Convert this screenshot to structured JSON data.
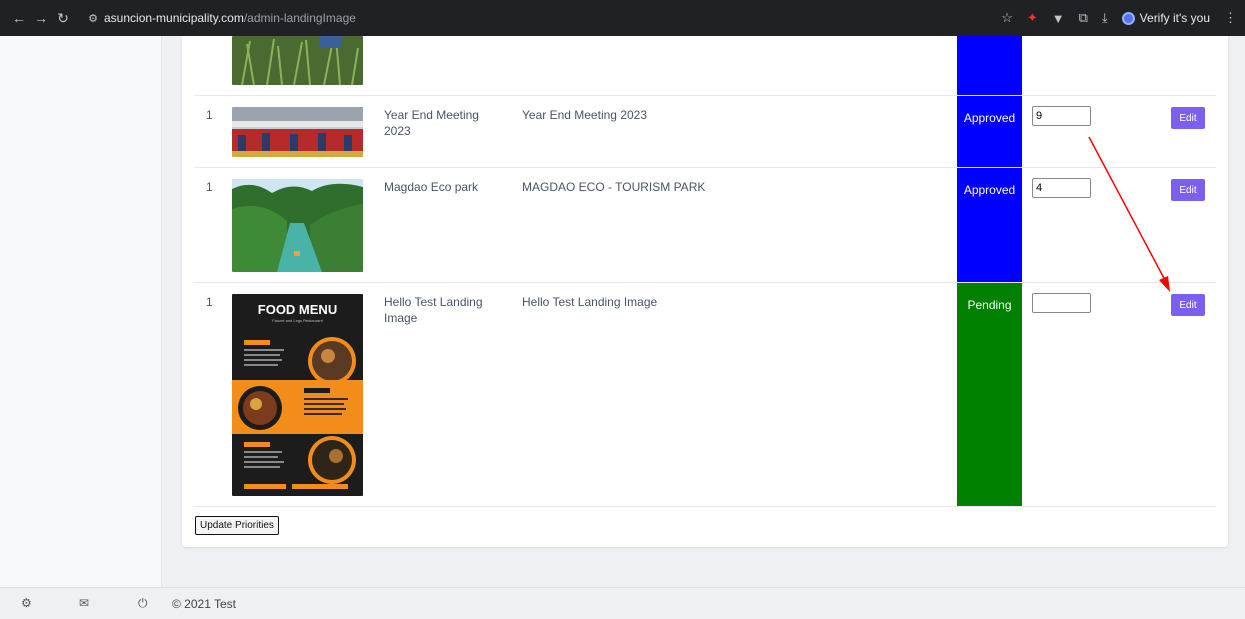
{
  "browser": {
    "url_host": "asuncion-municipality.com",
    "url_path": "/admin-landingImage",
    "profile_label": "Verify it's you"
  },
  "rows": [
    {
      "num": "1",
      "title": "Year End Meeting 2023",
      "desc": "Year End Meeting 2023",
      "status": "Approved",
      "priority": "9",
      "edit": "Edit"
    },
    {
      "num": "1",
      "title": "Magdao Eco park",
      "desc": "MAGDAO ECO - TOURISM PARK",
      "status": "Approved",
      "priority": "4",
      "edit": "Edit"
    },
    {
      "num": "1",
      "title": "Hello Test Landing Image",
      "desc": "Hello Test Landing Image",
      "status": "Pending",
      "priority": "",
      "edit": "Edit"
    }
  ],
  "food_menu": {
    "heading": "FOOD MENU",
    "sub": "Faucet and Legs Restaurant"
  },
  "update_button": "Update Priorities",
  "footer": {
    "copyright": "© 2021 Test"
  },
  "colors": {
    "approved": "#0000ff",
    "pending": "#008000",
    "edit": "#7d5ff0",
    "arrow": "#ff0000"
  },
  "icons": [
    "back-icon",
    "forward-icon",
    "reload-icon",
    "site-info-icon",
    "star-icon",
    "extension-icon",
    "download-icon",
    "settings-icon",
    "mail-icon",
    "power-icon"
  ]
}
